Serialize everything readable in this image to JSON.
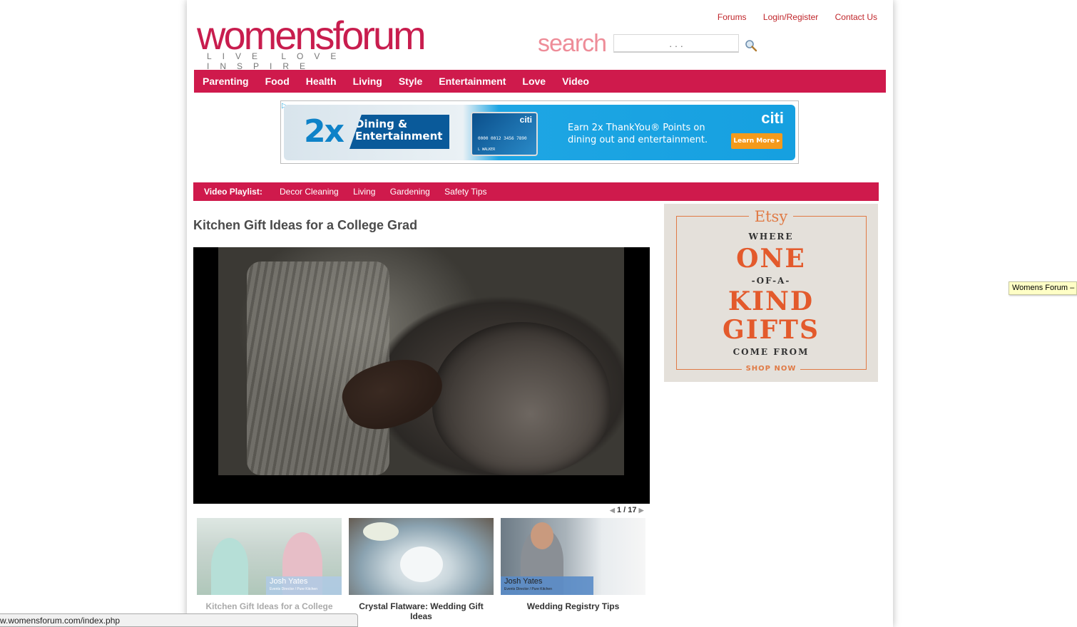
{
  "header": {
    "logo_text": "womensforum",
    "logo_tagline": "LIVE LOVE INSPIRE",
    "top_links": [
      "Forums",
      "Login/Register",
      "Contact Us"
    ],
    "search_label": "search",
    "search_placeholder": ". . ."
  },
  "main_nav": [
    "Parenting",
    "Food",
    "Health",
    "Living",
    "Style",
    "Entertainment",
    "Love",
    "Video"
  ],
  "ad_banner": {
    "big_text": "2x",
    "headline_1": "Dining &",
    "headline_2": "Entertainment",
    "card_number": "0000 0012 3456 7890",
    "card_name": "L WALKER",
    "card_brand": "citi",
    "copy_1": "Earn 2x ThankYou® Points on",
    "copy_2": "dining out and entertainment.",
    "brand": "citi",
    "button": "Learn More ▸"
  },
  "playlist": {
    "label": "Video Playlist:",
    "items": [
      "Decor Cleaning",
      "Living",
      "Gardening",
      "Safety Tips"
    ]
  },
  "article": {
    "title": "Kitchen Gift Ideas for a College Grad"
  },
  "pager": {
    "text": "1 / 17"
  },
  "thumbnails": [
    {
      "caption": "Kitchen Gift Ideas for a College",
      "overlay_name": "Josh Yates",
      "overlay_sub": "Events Director / Pure Kitchen"
    },
    {
      "caption": "Crystal Flatware: Wedding Gift Ideas"
    },
    {
      "caption": "Wedding Registry Tips",
      "overlay_name": "Josh Yates",
      "overlay_sub": "Events Director / Pure Kitchen"
    }
  ],
  "side_ad": {
    "brand": "Etsy",
    "line1": "WHERE",
    "line2": "ONE",
    "line3": "-OF-A-",
    "line4": "KIND",
    "line5": "GIFTS",
    "line6": "COME FROM",
    "cta": "SHOP NOW"
  },
  "tooltip": "Womens Forum – ",
  "status_bar": "w.womensforum.com/index.php",
  "colors": {
    "brand_pink": "#cf1a4c",
    "link_red": "#c0262b",
    "etsy_orange": "#e07a45"
  }
}
